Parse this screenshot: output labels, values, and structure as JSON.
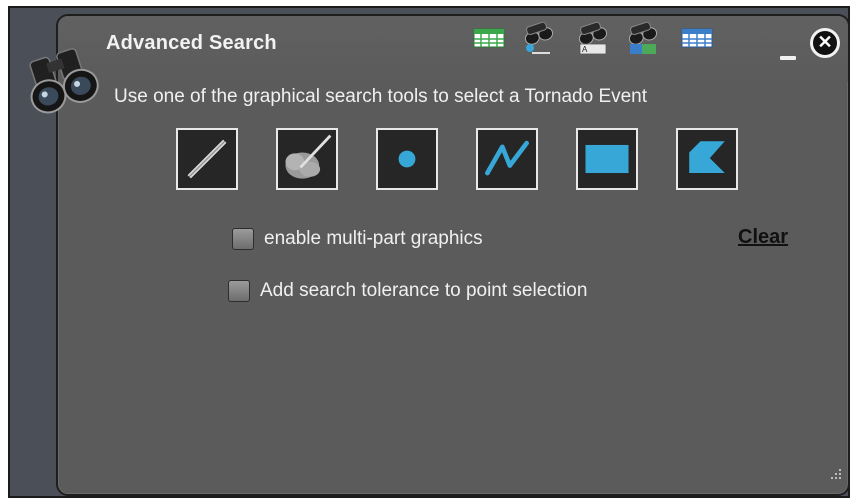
{
  "window": {
    "title": "Advanced Search",
    "instruction": "Use one of the graphical search tools to select a Tornado Event"
  },
  "toolbar_icons": [
    {
      "name": "table-grid-icon",
      "color": "#3aa84a"
    },
    {
      "name": "binoculars-point-icon"
    },
    {
      "name": "binoculars-text-icon"
    },
    {
      "name": "binoculars-map-icon"
    },
    {
      "name": "table-blue-icon",
      "color": "#3d7ec8"
    }
  ],
  "tools": [
    {
      "name": "draw-line-tool"
    },
    {
      "name": "freehand-area-tool"
    },
    {
      "name": "point-tool"
    },
    {
      "name": "polyline-tool"
    },
    {
      "name": "rectangle-tool"
    },
    {
      "name": "polygon-tool"
    }
  ],
  "options": {
    "multipart_label": "enable multi-part graphics",
    "tolerance_label": "Add search tolerance to point selection",
    "clear_label": "Clear"
  },
  "colors": {
    "panel": "#5b5b5b",
    "tool_accent": "#36a7d7",
    "text": "#f0f0f0"
  }
}
